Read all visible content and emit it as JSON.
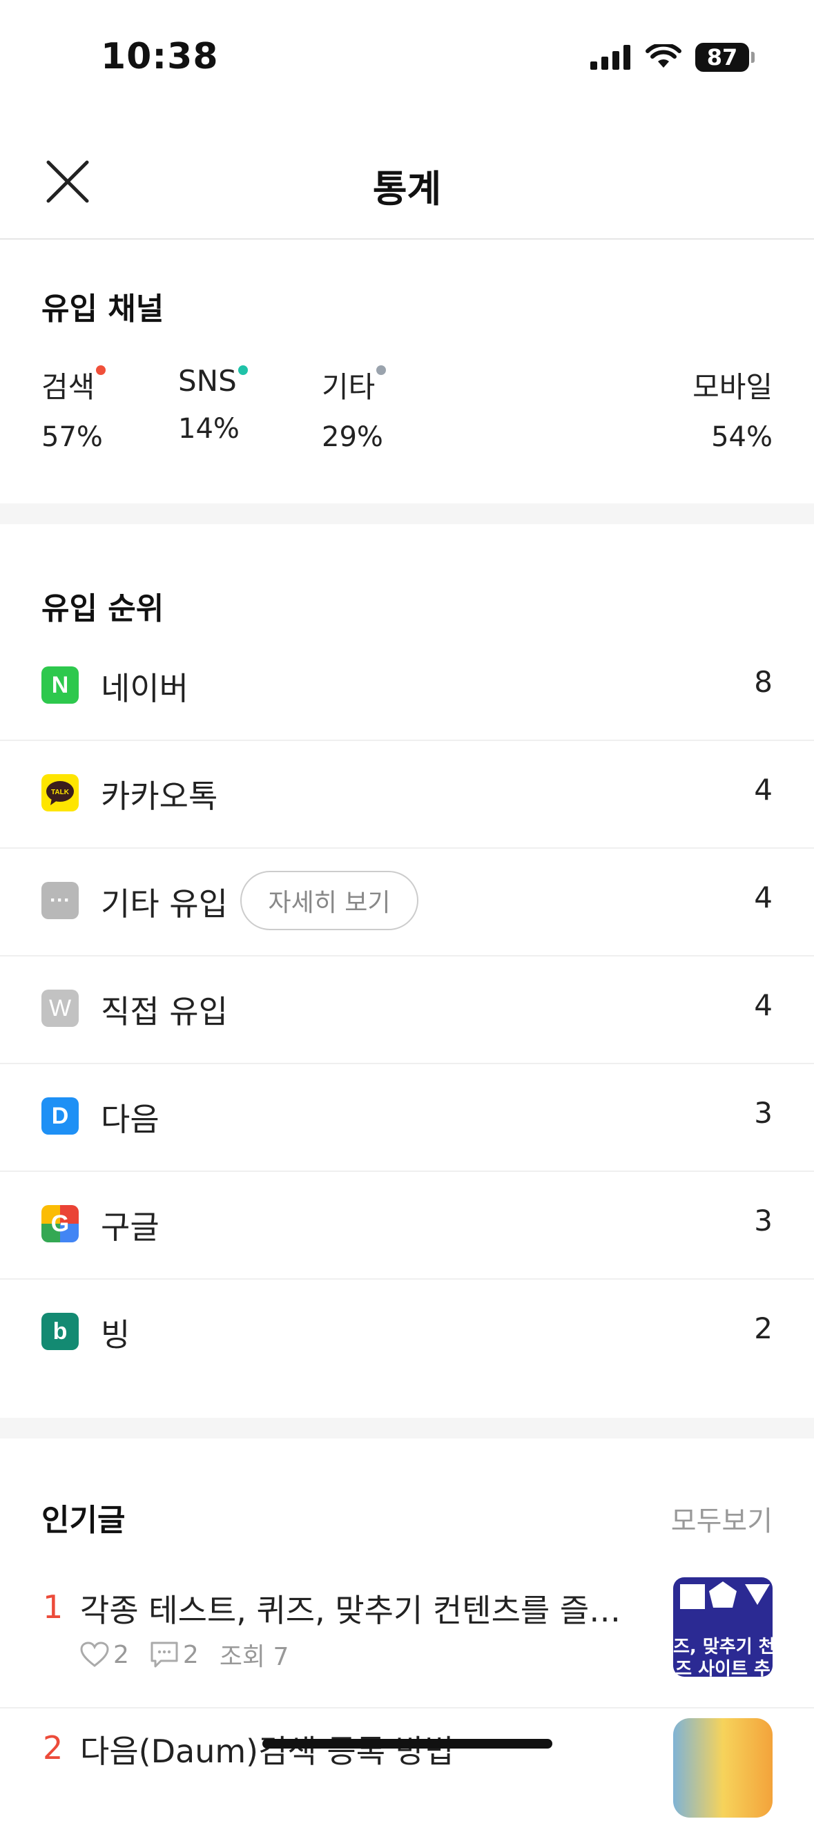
{
  "status_bar": {
    "time": "10:38",
    "battery": "87"
  },
  "header": {
    "title": "통계"
  },
  "channels": {
    "title": "유입 채널",
    "items": [
      {
        "label": "검색",
        "value": "57%",
        "dot_color": "#f0503a"
      },
      {
        "label": "SNS",
        "value": "14%",
        "dot_color": "#1fc2a8"
      },
      {
        "label": "기타",
        "value": "29%",
        "dot_color": "#9aa3ad"
      },
      {
        "label": "모바일",
        "value": "54%"
      }
    ]
  },
  "ranking": {
    "title": "유입 순위",
    "detail_button": "자세히 보기",
    "items": [
      {
        "label": "네이버",
        "count": "8",
        "icon": "naver-icon",
        "icon_text": "N",
        "color": "#2dc84d"
      },
      {
        "label": "카카오톡",
        "count": "4",
        "icon": "kakaotalk-icon",
        "icon_text": "TALK",
        "color": "#fee500"
      },
      {
        "label": "기타 유입",
        "count": "4",
        "icon": "more-dots-icon",
        "icon_text": "···",
        "color": "#b8b8b8"
      },
      {
        "label": "직접 유입",
        "count": "4",
        "icon": "direct-w-icon",
        "icon_text": "W",
        "color": "#c2c2c2"
      },
      {
        "label": "다음",
        "count": "3",
        "icon": "daum-icon",
        "icon_text": "D",
        "color": "#1e90f5"
      },
      {
        "label": "구글",
        "count": "3",
        "icon": "google-icon",
        "icon_text": "G",
        "color": "#ea4335"
      },
      {
        "label": "빙",
        "count": "2",
        "icon": "bing-icon",
        "icon_text": "b",
        "color": "#138a72"
      }
    ]
  },
  "popular": {
    "title": "인기글",
    "see_all": "모두보기",
    "posts": [
      {
        "rank": "1",
        "title": "각종 테스트, 퀴즈, 맞추기 컨텐츠를 즐기...",
        "likes": "2",
        "comments": "2",
        "views_label": "조회 7",
        "thumb_line1": "즈, 맞추기 천",
        "thumb_line2": "즈 사이트 추"
      },
      {
        "rank": "2",
        "title": "다음(Daum)검색 등록 방법"
      }
    ]
  }
}
